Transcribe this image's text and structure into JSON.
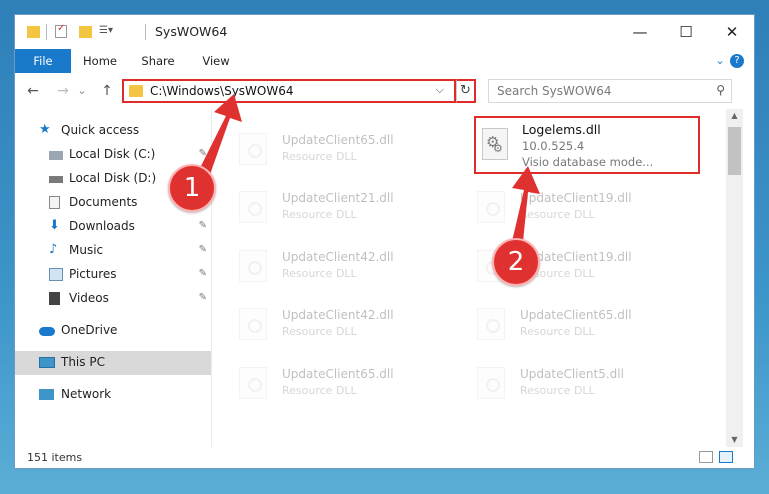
{
  "window": {
    "title": "SysWOW64",
    "controls": {
      "minimize": "—",
      "maximize": "☐",
      "close": "✕"
    }
  },
  "ribbon": {
    "tabs": [
      "File",
      "Home",
      "Share",
      "View"
    ],
    "expand_icon": "chevron-down-icon",
    "help_icon": "?"
  },
  "address": {
    "path": "C:\\Windows\\SysWOW64",
    "dropdown_glyph": "⌵",
    "refresh_glyph": "↻"
  },
  "search": {
    "placeholder": "Search SysWOW64",
    "icon": "⚲"
  },
  "nav_glyphs": {
    "back": "←",
    "forward": "→",
    "recent": "⌄",
    "up": "↑"
  },
  "sidebar": {
    "items": [
      {
        "label": "Quick access",
        "icon": "star-icon",
        "pinned": false
      },
      {
        "label": "Local Disk (C:)",
        "icon": "drive-icon",
        "pinned": true
      },
      {
        "label": "Local Disk (D:)",
        "icon": "drive-icon",
        "pinned": true
      },
      {
        "label": "Documents",
        "icon": "documents-icon",
        "pinned": true
      },
      {
        "label": "Downloads",
        "icon": "downloads-icon",
        "pinned": true
      },
      {
        "label": "Music",
        "icon": "music-icon",
        "pinned": true
      },
      {
        "label": "Pictures",
        "icon": "pictures-icon",
        "pinned": true
      },
      {
        "label": "Videos",
        "icon": "videos-icon",
        "pinned": true
      },
      {
        "label": "OneDrive",
        "icon": "cloud-icon",
        "pinned": false
      },
      {
        "label": "This PC",
        "icon": "computer-icon",
        "pinned": false,
        "selected": true
      },
      {
        "label": "Network",
        "icon": "network-icon",
        "pinned": false
      }
    ],
    "pin_glyph": "📌"
  },
  "files": {
    "left_column": [
      {
        "name": "UpdateClient65.dll",
        "type": "Resource DLL"
      },
      {
        "name": "UpdateClient21.dll",
        "type": "Resource DLL"
      },
      {
        "name": "UpdateClient42.dll",
        "type": "Resource DLL"
      },
      {
        "name": "UpdateClient42.dll",
        "type": "Resource DLL"
      },
      {
        "name": "UpdateClient65.dll",
        "type": "Resource DLL"
      }
    ],
    "right_column": [
      {
        "name": "UpdateClient19.dll",
        "type": "Resource DLL"
      },
      {
        "name": "UpdateClient19.dll",
        "type": "Resource DLL"
      },
      {
        "name": "UpdateClient65.dll",
        "type": "Resource DLL"
      },
      {
        "name": "UpdateClient5.dll",
        "type": "Resource DLL"
      }
    ],
    "highlighted": {
      "name": "Logelems.dll",
      "version": "10.0.525.4",
      "description": "Visio database mode..."
    }
  },
  "status": {
    "item_count": "151 items"
  },
  "annotations": {
    "marker_1": "1",
    "marker_2": "2",
    "color": "#e03131"
  }
}
